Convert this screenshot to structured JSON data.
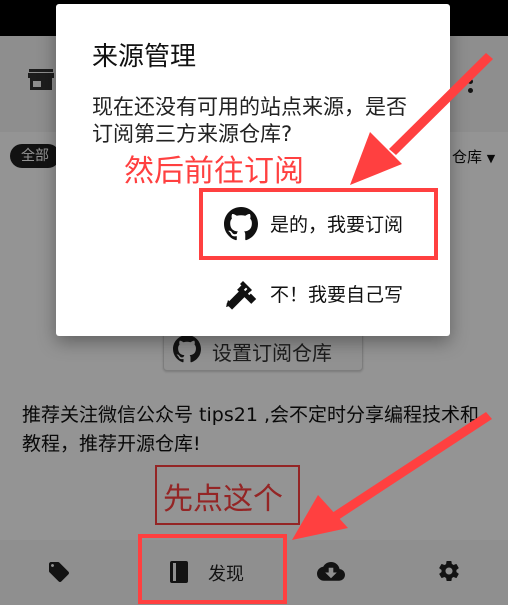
{
  "filter": {
    "all_chip": "全部",
    "repo_dropdown": "仓库"
  },
  "main": {
    "setup_button": "设置订阅仓库",
    "tips_text": "推荐关注微信公众号 tips21 ,会不定时分享编程技术和教程，推荐开源仓库!"
  },
  "bottom_nav": {
    "discover_label": "发现"
  },
  "dialog": {
    "title": "来源管理",
    "message": "现在还没有可用的站点来源，是否订阅第三方来源仓库?",
    "subscribe_label": "是的，我要订阅",
    "self_label": "不！我要自己写"
  },
  "annotations": {
    "step1": "然后前往订阅",
    "step2": "先点这个",
    "color": "#ff4040"
  },
  "icons": {
    "store": "store-icon",
    "menu": "more-vert-icon",
    "github": "github-icon",
    "tag": "tag-icon",
    "book": "book-icon",
    "download": "cloud-download-icon",
    "settings": "gear-icon",
    "edit": "pencil-ruler-icon"
  }
}
